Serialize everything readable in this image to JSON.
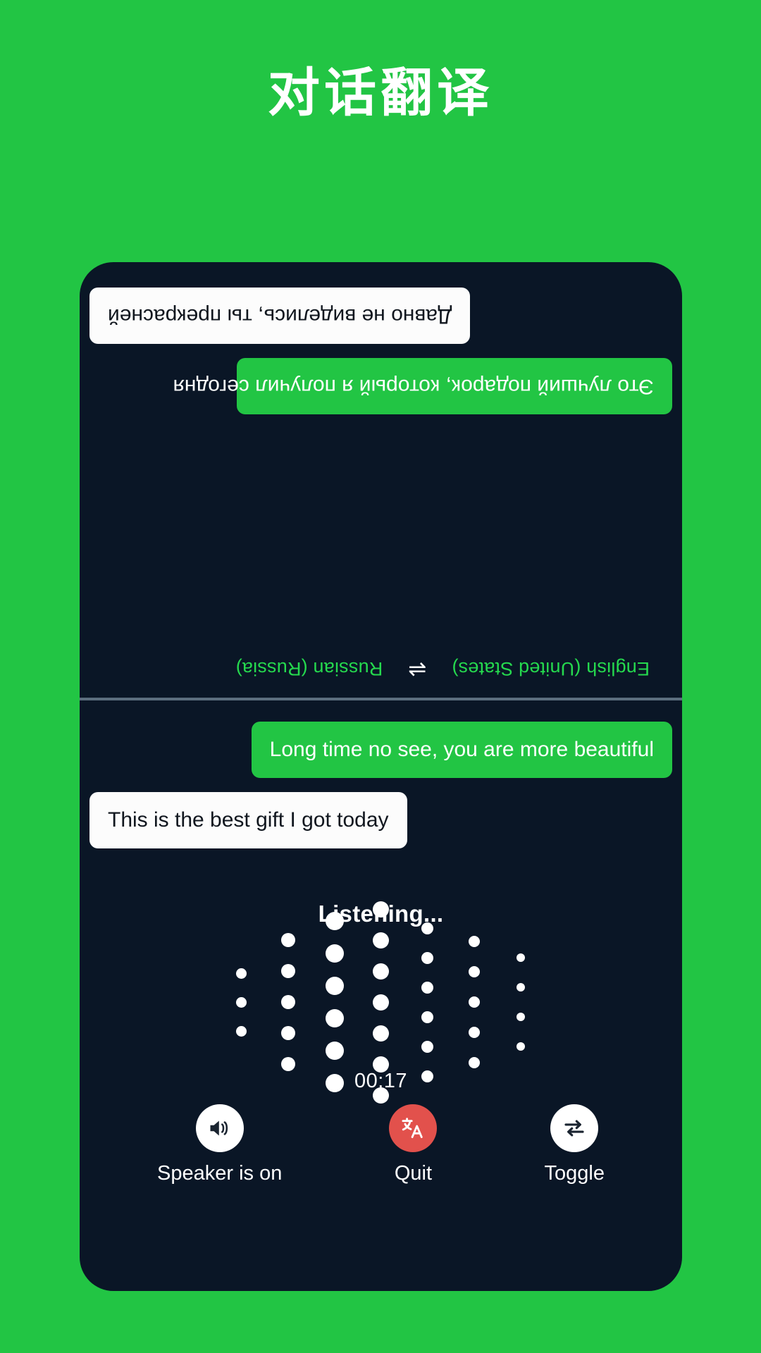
{
  "page": {
    "title": "对话翻译",
    "background_color": "#22C544",
    "screen_color": "#0A1626"
  },
  "languages": {
    "source": "English (United States)",
    "swap_icon": "swap-horizontal-icon",
    "swap_glyph": "⇌",
    "target": "Russian (Russia)"
  },
  "remote_pane": {
    "rotated": true,
    "messages": [
      {
        "id": "remote-msg-1",
        "text": "Это лучший подарок, который я получил сегодня",
        "style": "green",
        "align": "left"
      },
      {
        "id": "remote-msg-2",
        "text": "Давно не виделись, ты прекрасней",
        "style": "white",
        "align": "right"
      }
    ]
  },
  "local_pane": {
    "messages": [
      {
        "id": "local-msg-1",
        "text": "Long time no see, you are more beautiful",
        "style": "green",
        "align": "right"
      },
      {
        "id": "local-msg-2",
        "text": "This is the best gift I got today",
        "style": "white",
        "align": "left"
      }
    ]
  },
  "status": {
    "listening_label": "Listening...",
    "timer": "00:17"
  },
  "visualizer": {
    "type": "dot-wave",
    "dot_color": "#FFFFFF",
    "columns": [
      {
        "count": 3,
        "size": 15,
        "gap": 26
      },
      {
        "count": 5,
        "size": 20,
        "gap": 24
      },
      {
        "count": 6,
        "size": 26,
        "gap": 20
      },
      {
        "count": 7,
        "size": 23,
        "gap": 21
      },
      {
        "count": 6,
        "size": 17,
        "gap": 25
      },
      {
        "count": 5,
        "size": 16,
        "gap": 27
      },
      {
        "count": 4,
        "size": 12,
        "gap": 30
      }
    ]
  },
  "controls": [
    {
      "id": "speaker",
      "label": "Speaker is on",
      "icon": "speaker-on-icon",
      "circle_color": "#FFFFFF",
      "icon_color": "#1A2430"
    },
    {
      "id": "quit",
      "label": "Quit",
      "icon": "translate-icon",
      "circle_color": "#E2514C",
      "icon_color": "#FFFFFF"
    },
    {
      "id": "toggle",
      "label": "Toggle",
      "icon": "swap-arrows-icon",
      "circle_color": "#FFFFFF",
      "icon_color": "#1A2430"
    }
  ]
}
